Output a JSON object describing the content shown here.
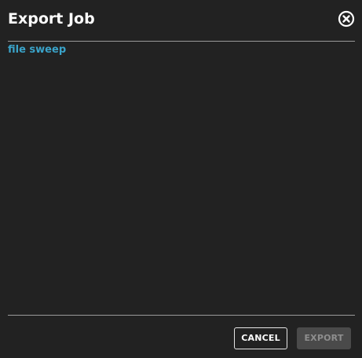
{
  "dialog": {
    "title": "Export Job",
    "job_name": "file sweep"
  },
  "buttons": {
    "cancel_label": "CANCEL",
    "export_label": "EXPORT"
  },
  "icons": {
    "close": "close-circle-icon"
  },
  "colors": {
    "background": "#222222",
    "accent": "#3aa3c9",
    "divider": "#9a9a9a",
    "disabled_button": "#4a4a4a"
  }
}
